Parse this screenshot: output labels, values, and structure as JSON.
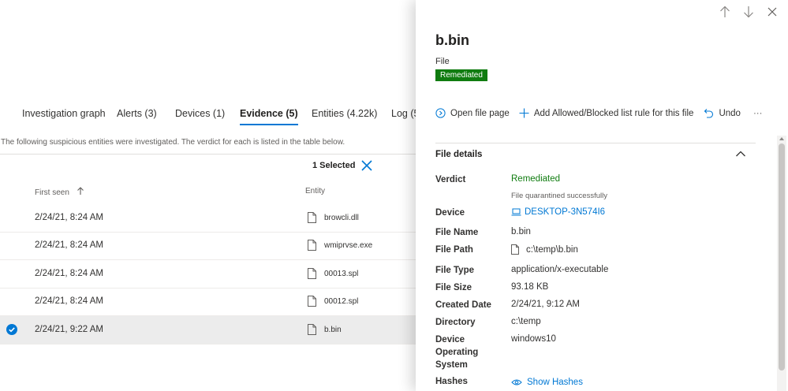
{
  "tabs": [
    {
      "label": "Investigation graph"
    },
    {
      "label": "Alerts  (3)"
    },
    {
      "label": "Devices  (1)"
    },
    {
      "label": "Evidence  (5)"
    },
    {
      "label": "Entities  (4.22k)"
    },
    {
      "label": "Log  (5"
    }
  ],
  "description": "The following suspicious entities were investigated. The verdict for each is listed in the table below.",
  "selection": {
    "label": "1 Selected"
  },
  "table": {
    "columns": {
      "first_seen": "First seen",
      "entity": "Entity"
    },
    "rows": [
      {
        "date": "2/24/21, 8:24 AM",
        "entity": "browcli.dll"
      },
      {
        "date": "2/24/21, 8:24 AM",
        "entity": "wmiprvse.exe"
      },
      {
        "date": "2/24/21, 8:24 AM",
        "entity": "00013.spl"
      },
      {
        "date": "2/24/21, 8:24 AM",
        "entity": "00012.spl"
      },
      {
        "date": "2/24/21, 9:22 AM",
        "entity": "b.bin",
        "selected": true
      }
    ]
  },
  "panel": {
    "title": "b.bin",
    "type": "File",
    "badge": "Remediated",
    "actions": {
      "open": "Open file page",
      "add": "Add Allowed/Blocked list rule for this file",
      "undo": "Undo",
      "more": "···"
    },
    "section": "File details",
    "labels": {
      "verdict": "Verdict",
      "device": "Device",
      "file_name": "File Name",
      "file_path": "File Path",
      "file_type": "File Type",
      "file_size": "File Size",
      "created": "Created Date",
      "directory": "Directory",
      "os1": "Device",
      "os2": "Operating",
      "os3": "System",
      "hashes": "Hashes"
    },
    "values": {
      "verdict": "Remediated",
      "verdict_note": "File quarantined successfully",
      "device": "DESKTOP-3N574I6",
      "file_name": "b.bin",
      "file_path": "c:\\temp\\b.bin",
      "file_type": "application/x-executable",
      "file_size": "93.18 KB",
      "created": "2/24/21, 9:12 AM",
      "directory": "c:\\temp",
      "os": "windows10",
      "hashes": "Show Hashes"
    }
  },
  "colors": {
    "accent": "#0078d4",
    "success": "#107c10"
  },
  "icons": [
    "arrow-up-icon",
    "arrow-down-icon",
    "close-icon",
    "file-icon",
    "sort-ascending-icon",
    "checkmark-icon",
    "open-icon",
    "add-icon",
    "undo-icon",
    "more-icon",
    "chevron-up-icon",
    "laptop-icon",
    "eye-icon"
  ]
}
